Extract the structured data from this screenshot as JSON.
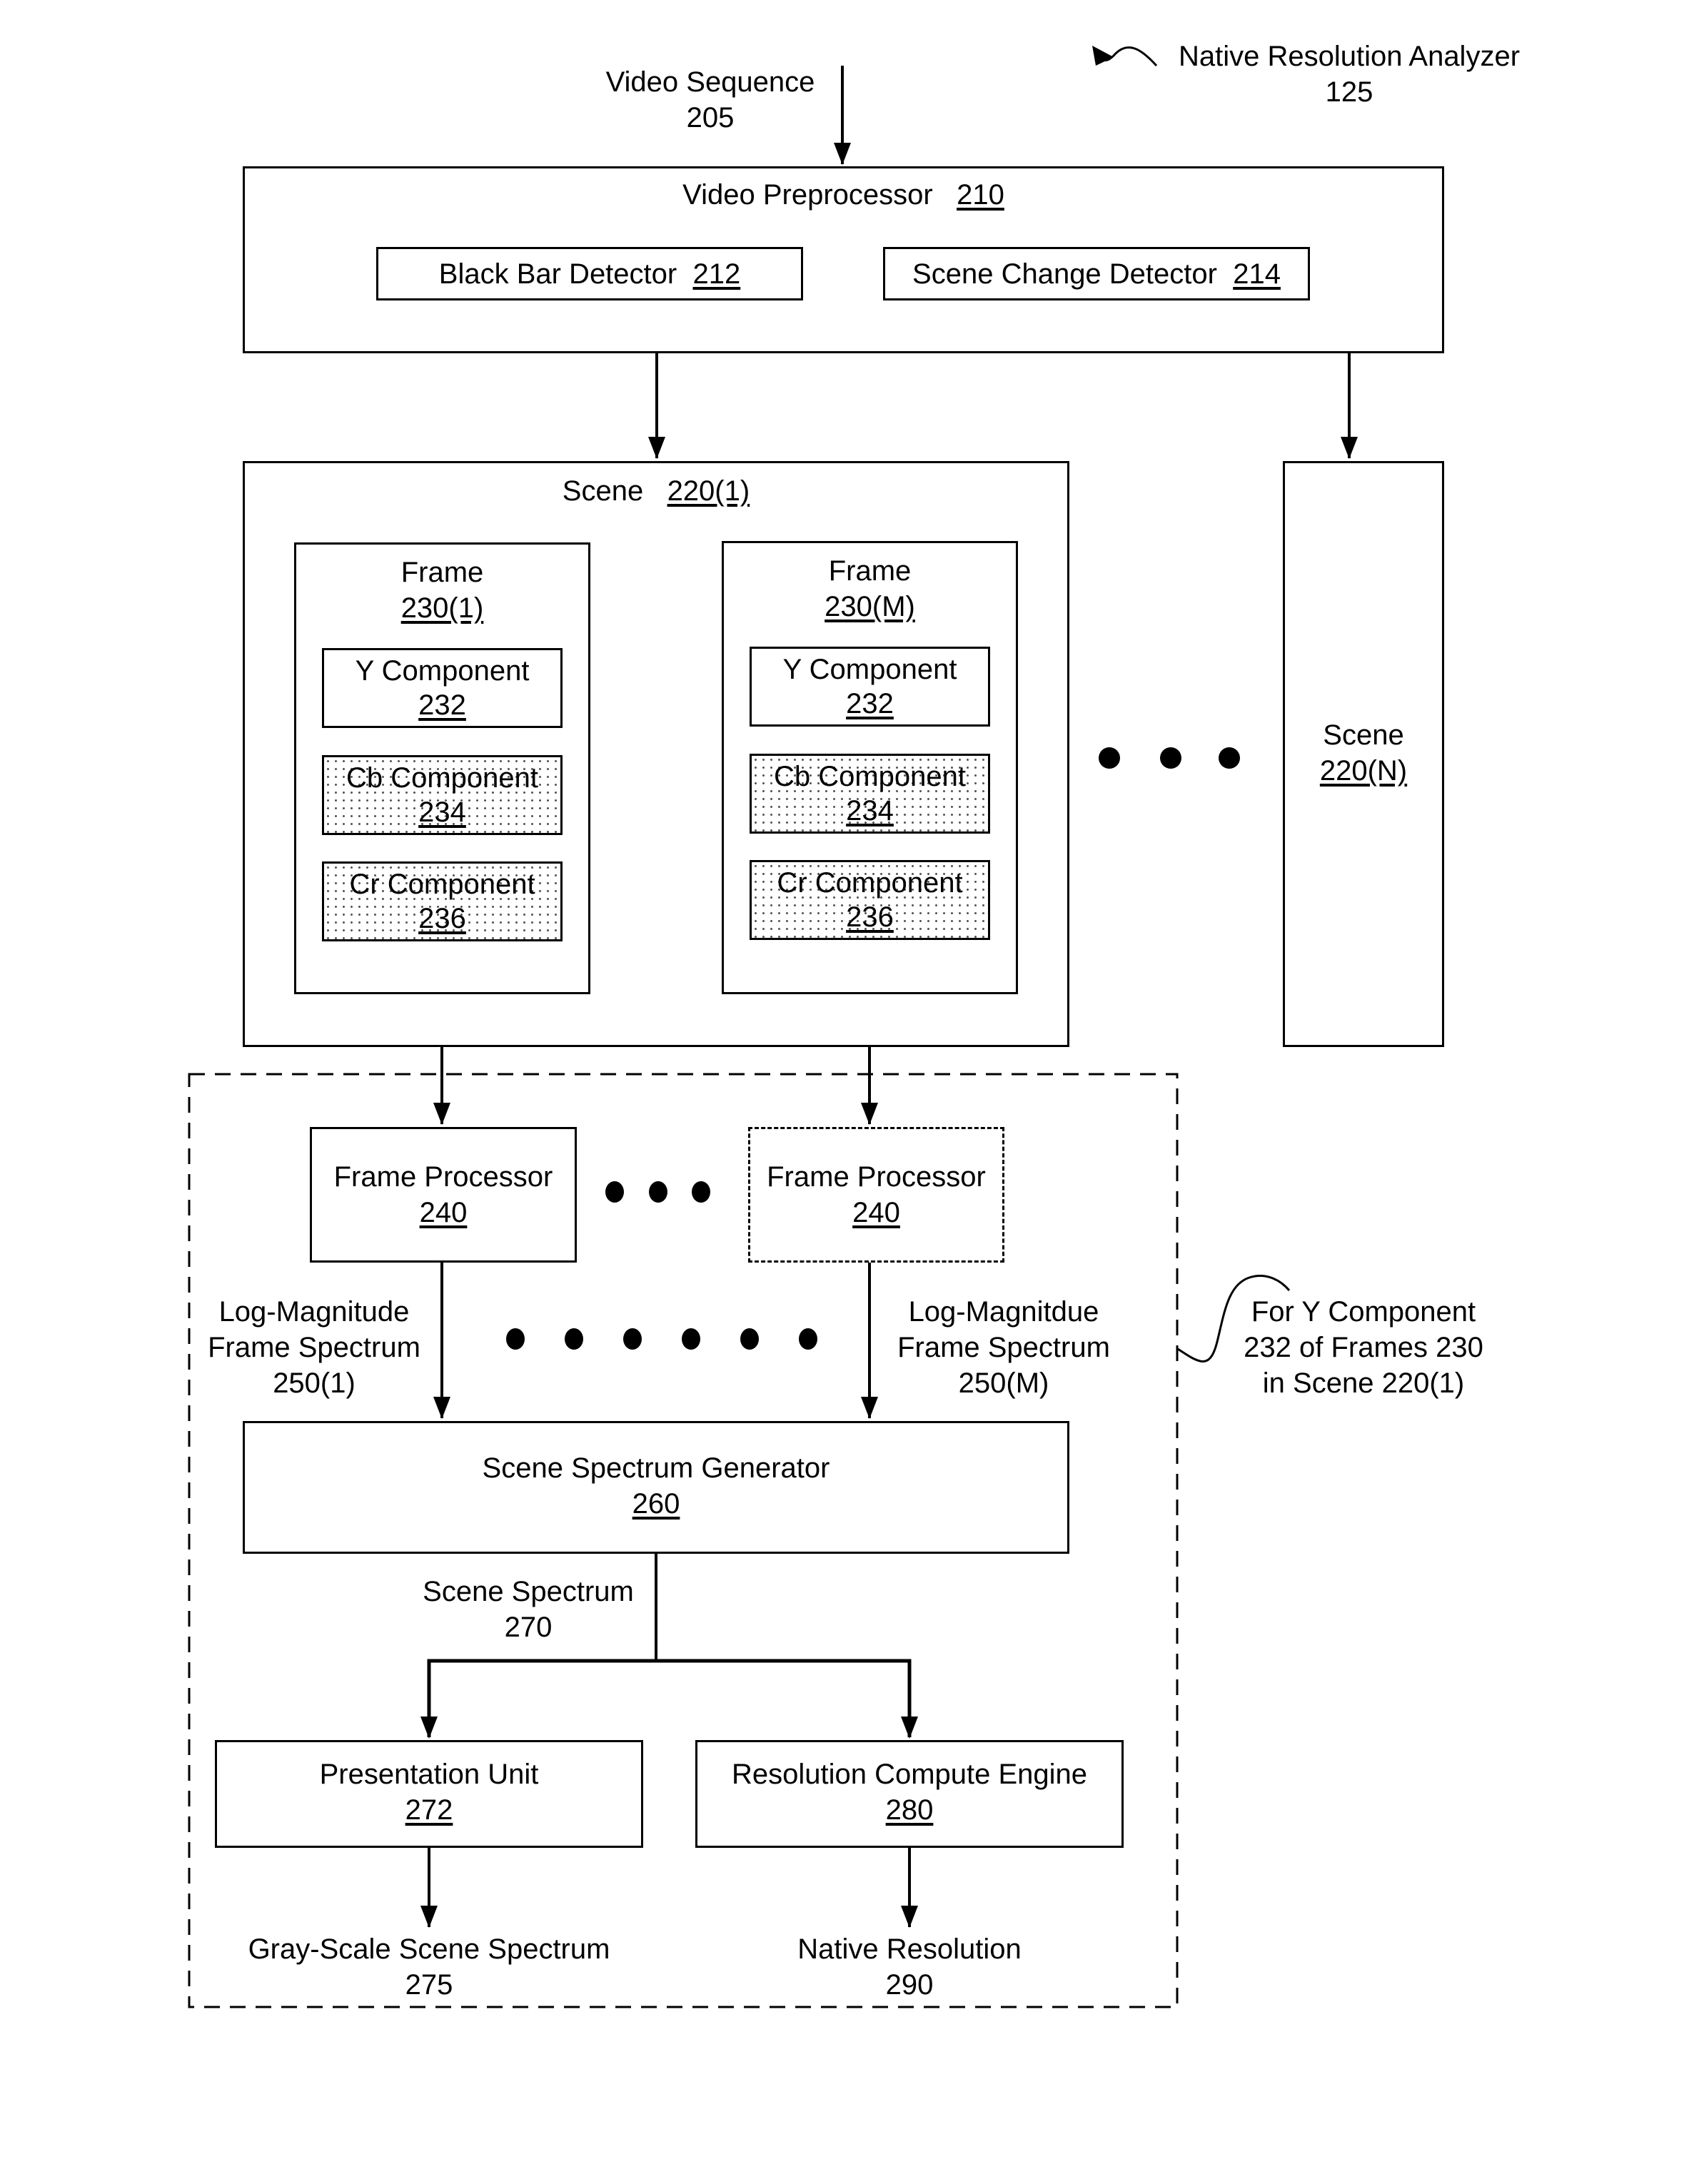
{
  "figure": {
    "analyzer": {
      "name": "Native Resolution Analyzer",
      "ref": "125"
    },
    "input": {
      "name": "Video Sequence",
      "ref": "205"
    },
    "preprocessor": {
      "name": "Video Preprocessor",
      "ref": "210",
      "black_bar": {
        "name": "Black Bar Detector",
        "ref": "212"
      },
      "scene_change": {
        "name": "Scene Change Detector",
        "ref": "214"
      }
    },
    "scene_first": {
      "name": "Scene",
      "ref": "220(1)"
    },
    "scene_last": {
      "name": "Scene",
      "ref": "220(N)"
    },
    "frames": [
      {
        "name": "Frame",
        "ref": "230(1)",
        "y": {
          "name": "Y Component",
          "ref": "232"
        },
        "cb": {
          "name": "Cb Component",
          "ref": "234"
        },
        "cr": {
          "name": "Cr Component",
          "ref": "236"
        }
      },
      {
        "name": "Frame",
        "ref": "230(M)",
        "y": {
          "name": "Y Component",
          "ref": "232"
        },
        "cb": {
          "name": "Cb Component",
          "ref": "234"
        },
        "cr": {
          "name": "Cr Component",
          "ref": "236"
        }
      }
    ],
    "frame_processors": [
      {
        "name": "Frame Processor",
        "ref": "240"
      },
      {
        "name": "Frame Processor",
        "ref": "240"
      }
    ],
    "spectra": [
      {
        "line1": "Log-Magnitude",
        "line2": "Frame Spectrum",
        "ref": "250(1)"
      },
      {
        "line1": "Log-Magnitdue",
        "line2": "Frame Spectrum",
        "ref": "250(M)"
      }
    ],
    "group_note": {
      "line1": "For Y Component",
      "line2": "232 of Frames 230",
      "line3": "in Scene 220(1)"
    },
    "scene_spectrum_generator": {
      "name": "Scene Spectrum Generator",
      "ref": "260"
    },
    "scene_spectrum": {
      "name": "Scene Spectrum",
      "ref": "270"
    },
    "presentation_unit": {
      "name": "Presentation Unit",
      "ref": "272"
    },
    "resolution_engine": {
      "name": "Resolution Compute Engine",
      "ref": "280"
    },
    "gray_scale": {
      "name": "Gray-Scale Scene Spectrum",
      "ref": "275"
    },
    "native_resolution": {
      "name": "Native Resolution",
      "ref": "290"
    }
  }
}
